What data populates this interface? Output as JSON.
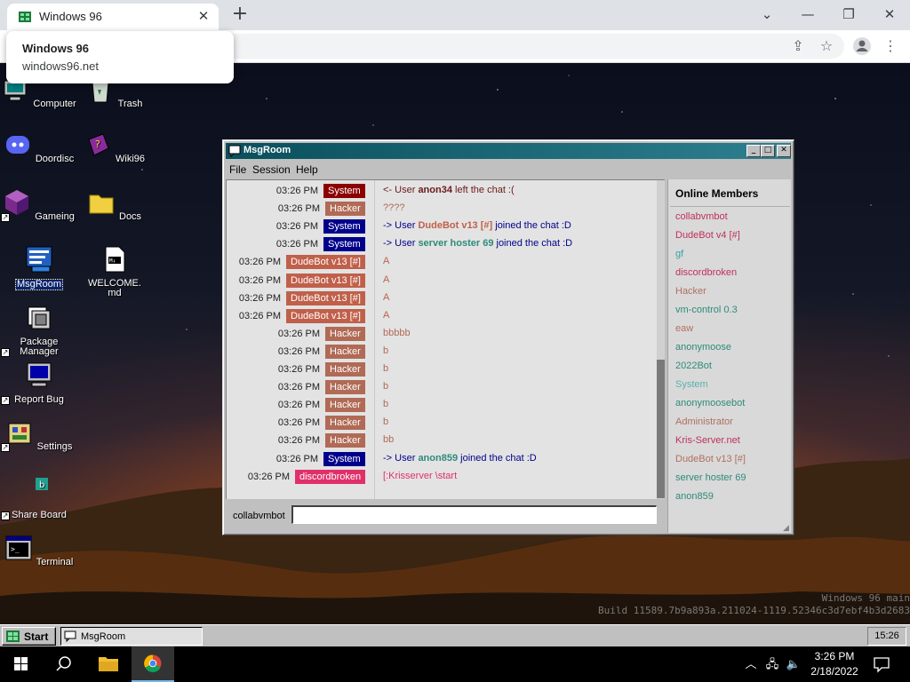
{
  "browser": {
    "tab_title": "Windows 96",
    "hover_card": {
      "title": "Windows 96",
      "url": "windows96.net"
    }
  },
  "desktop": {
    "icons": [
      {
        "label": "Computer"
      },
      {
        "label": "Trash"
      },
      {
        "label": "Doordisc"
      },
      {
        "label": "Wiki96"
      },
      {
        "label": "Gameing"
      },
      {
        "label": "Docs"
      },
      {
        "label": "MsgRoom"
      },
      {
        "label": "WELCOME.md"
      },
      {
        "label": "Package Manager"
      },
      {
        "label": "Report Bug"
      },
      {
        "label": "Settings"
      },
      {
        "label": "Share Board"
      },
      {
        "label": "Terminal"
      }
    ],
    "watermark_line1": "Windows 96 main",
    "watermark_line2": "Build 11589.7b9a893a.211024-1119.52346c3d7ebf4b3d2683"
  },
  "msgroom": {
    "title": "MsgRoom",
    "menu": [
      "File",
      "Session",
      "Help"
    ],
    "messages": [
      {
        "time": "03:26 PM",
        "user": "System",
        "user_color": "#8b0000",
        "parts": [
          {
            "t": "<- User "
          },
          {
            "t": "anon34",
            "b": true,
            "c": "#6b1a1a"
          },
          {
            "t": " left the chat :("
          }
        ],
        "text_color": "#6b1a1a"
      },
      {
        "time": "03:26 PM",
        "user": "Hacker",
        "user_color": "#b06a55",
        "parts": [
          {
            "t": "????"
          }
        ],
        "text_color": "#b06a55"
      },
      {
        "time": "03:26 PM",
        "user": "System",
        "user_color": "#00008b",
        "parts": [
          {
            "t": "-> User "
          },
          {
            "t": "DudeBot v13 [#]",
            "b": true,
            "c": "#c0604a"
          },
          {
            "t": " joined the chat :D"
          }
        ],
        "text_color": "#00008b"
      },
      {
        "time": "03:26 PM",
        "user": "System",
        "user_color": "#00008b",
        "parts": [
          {
            "t": "-> User "
          },
          {
            "t": "server hoster 69",
            "b": true,
            "c": "#2e8b7a"
          },
          {
            "t": " joined the chat :D"
          }
        ],
        "text_color": "#00008b"
      },
      {
        "time": "03:26 PM",
        "user": "DudeBot v13 [#]",
        "user_color": "#c0604a",
        "parts": [
          {
            "t": "A"
          }
        ],
        "text_color": "#c0604a"
      },
      {
        "time": "03:26 PM",
        "user": "DudeBot v13 [#]",
        "user_color": "#c0604a",
        "parts": [
          {
            "t": "A"
          }
        ],
        "text_color": "#c0604a"
      },
      {
        "time": "03:26 PM",
        "user": "DudeBot v13 [#]",
        "user_color": "#c0604a",
        "parts": [
          {
            "t": "A"
          }
        ],
        "text_color": "#c0604a"
      },
      {
        "time": "03:26 PM",
        "user": "DudeBot v13 [#]",
        "user_color": "#c0604a",
        "parts": [
          {
            "t": "A"
          }
        ],
        "text_color": "#c0604a"
      },
      {
        "time": "03:26 PM",
        "user": "Hacker",
        "user_color": "#b06a55",
        "parts": [
          {
            "t": "bbbbb"
          }
        ],
        "text_color": "#b06a55"
      },
      {
        "time": "03:26 PM",
        "user": "Hacker",
        "user_color": "#b06a55",
        "parts": [
          {
            "t": "b"
          }
        ],
        "text_color": "#b06a55"
      },
      {
        "time": "03:26 PM",
        "user": "Hacker",
        "user_color": "#b06a55",
        "parts": [
          {
            "t": "b"
          }
        ],
        "text_color": "#b06a55"
      },
      {
        "time": "03:26 PM",
        "user": "Hacker",
        "user_color": "#b06a55",
        "parts": [
          {
            "t": "b"
          }
        ],
        "text_color": "#b06a55"
      },
      {
        "time": "03:26 PM",
        "user": "Hacker",
        "user_color": "#b06a55",
        "parts": [
          {
            "t": "b"
          }
        ],
        "text_color": "#b06a55"
      },
      {
        "time": "03:26 PM",
        "user": "Hacker",
        "user_color": "#b06a55",
        "parts": [
          {
            "t": "b"
          }
        ],
        "text_color": "#b06a55"
      },
      {
        "time": "03:26 PM",
        "user": "Hacker",
        "user_color": "#b06a55",
        "parts": [
          {
            "t": "bb"
          }
        ],
        "text_color": "#b06a55"
      },
      {
        "time": "03:26 PM",
        "user": "System",
        "user_color": "#00008b",
        "parts": [
          {
            "t": "-> User "
          },
          {
            "t": "anon859",
            "b": true,
            "c": "#2e8b7a"
          },
          {
            "t": " joined the chat :D"
          }
        ],
        "text_color": "#00008b"
      },
      {
        "time": "03:26 PM",
        "user": "discordbroken",
        "user_color": "#e0306a",
        "parts": [
          {
            "t": "[:Krisserver \\start"
          }
        ],
        "text_color": "#e0306a"
      }
    ],
    "members_title": "Online Members",
    "members": [
      {
        "name": "collabvmbot",
        "color": "#c0305a"
      },
      {
        "name": "DudeBot v4 [#]",
        "color": "#c0305a"
      },
      {
        "name": "gf",
        "color": "#3aa0a0"
      },
      {
        "name": "discordbroken",
        "color": "#c0305a"
      },
      {
        "name": "Hacker",
        "color": "#b07060"
      },
      {
        "name": "vm-control 0.3",
        "color": "#2e8b7a"
      },
      {
        "name": "eaw",
        "color": "#b07060"
      },
      {
        "name": "anonymoose",
        "color": "#2e8b7a"
      },
      {
        "name": "2022Bot",
        "color": "#2e8b7a"
      },
      {
        "name": "System",
        "color": "#5ab0b0"
      },
      {
        "name": "anonymoosebot",
        "color": "#2e8b7a"
      },
      {
        "name": "Administrator",
        "color": "#b07060"
      },
      {
        "name": "Kris-Server.net",
        "color": "#c0305a"
      },
      {
        "name": "DudeBot v13 [#]",
        "color": "#b07060"
      },
      {
        "name": "server hoster 69",
        "color": "#2e8b7a"
      },
      {
        "name": "anon859",
        "color": "#2e8b7a"
      }
    ],
    "input_nick": "collabvmbot",
    "input_value": ""
  },
  "w96_taskbar": {
    "start_label": "Start",
    "tasks": [
      {
        "label": "MsgRoom"
      }
    ],
    "clock": "15:26"
  },
  "win10_taskbar": {
    "time": "3:26 PM",
    "date": "2/18/2022"
  }
}
